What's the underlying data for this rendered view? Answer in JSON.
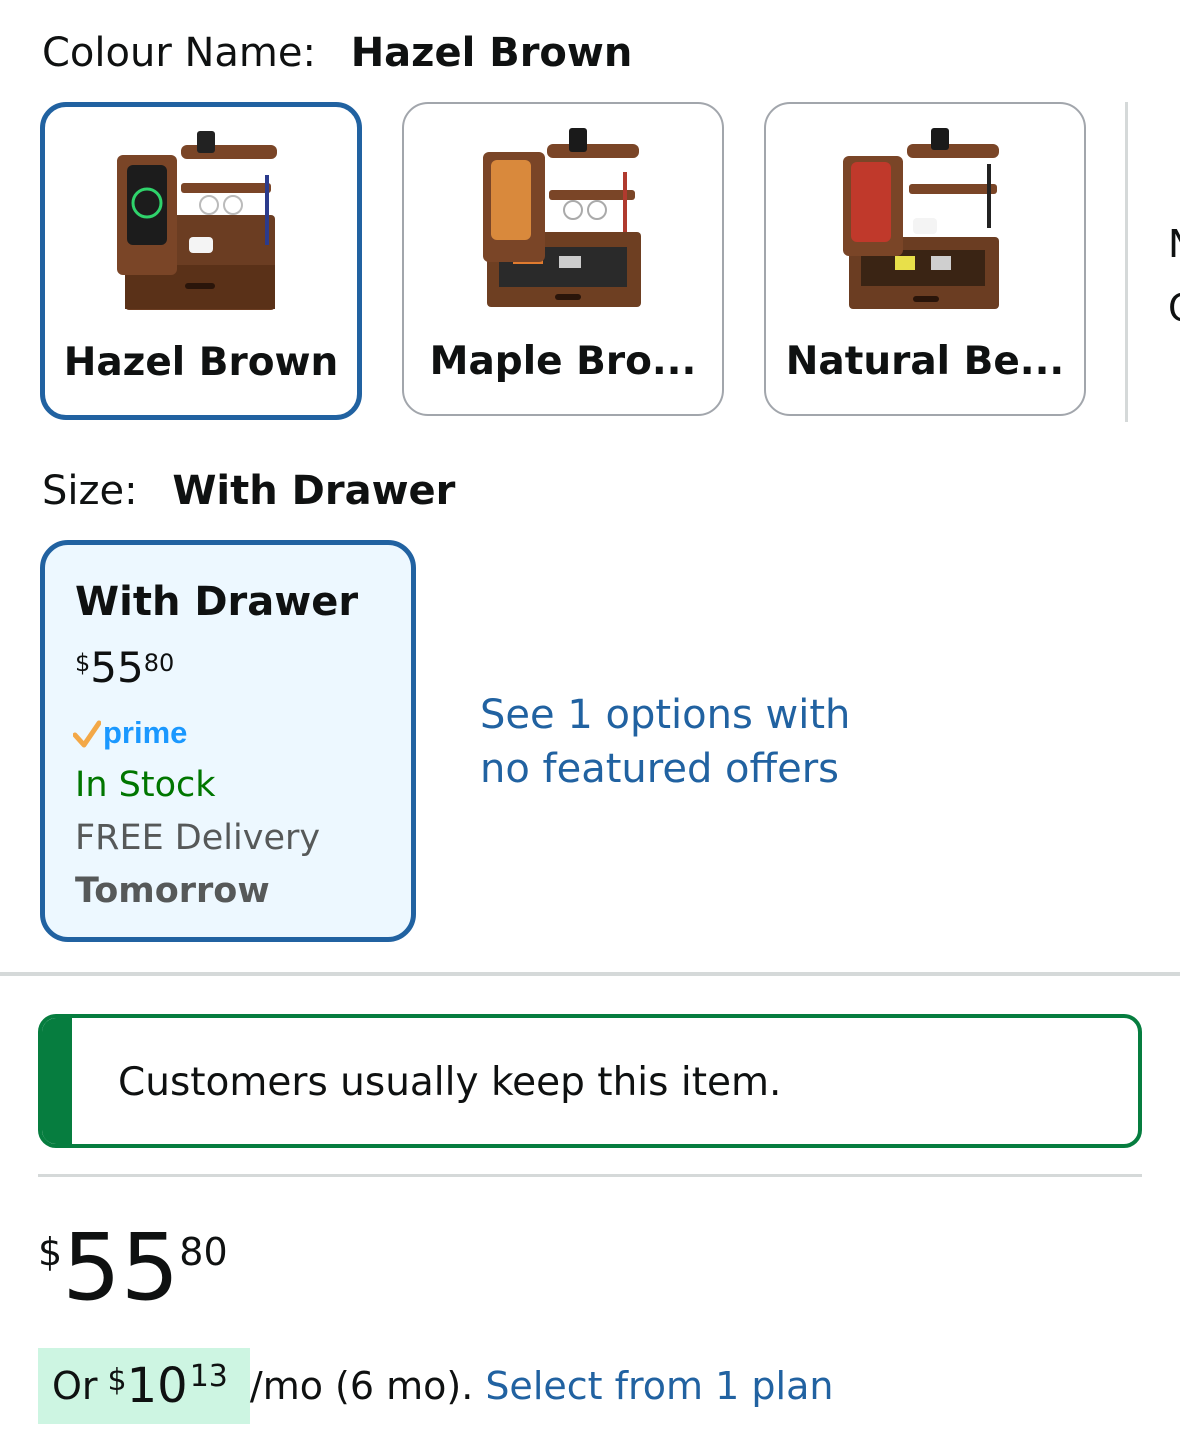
{
  "colour": {
    "label": "Colour Name:",
    "selected": "Hazel Brown",
    "swatches": [
      {
        "name": "Hazel Brown",
        "selected": true
      },
      {
        "name": "Maple Bro...",
        "selected": false
      },
      {
        "name": "Natural Be...",
        "selected": false
      }
    ],
    "cut_off_text": [
      "N",
      "C"
    ]
  },
  "size": {
    "label": "Size:",
    "selected": "With Drawer",
    "card": {
      "title": "With Drawer",
      "price_symbol": "$",
      "price_whole": "55",
      "price_fraction": "80",
      "prime_label": "prime",
      "stock": "In Stock",
      "delivery": "FREE Delivery",
      "delivery_day": "Tomorrow"
    },
    "options_link": "See 1 options with no featured offers"
  },
  "keep_notice": "Customers usually keep this item.",
  "price": {
    "symbol": "$",
    "whole": "55",
    "fraction": "80"
  },
  "installment": {
    "prefix": "Or",
    "symbol": "$",
    "whole": "10",
    "fraction": "13",
    "term": "/mo (6 mo).",
    "link": "Select from 1 plan"
  },
  "colors": {
    "selected_border": "#2162a1",
    "link": "#2162a1",
    "in_stock": "#007600",
    "notice_green": "#067d3f",
    "installment_highlight": "#cdf5e2",
    "prime_blue": "#1a98ff",
    "prime_check": "#f3a847"
  }
}
